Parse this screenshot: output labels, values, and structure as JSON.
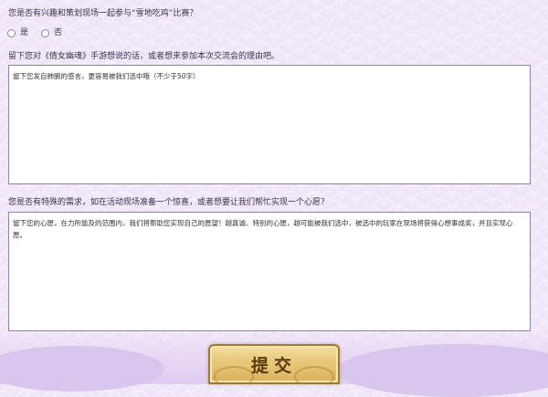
{
  "form": {
    "question1": "您是否有兴趣和策划现场一起参与“雪地吃鸡”比赛？",
    "options": [
      {
        "label": "是"
      },
      {
        "label": "否"
      }
    ],
    "question2": "留下您对《倩女幽魂》手游想说的话，或者想来参加本次交流会的理由吧。",
    "textarea1": {
      "placeholder": "留下您发自肺腑的感言，更容易被我们选中哦（不少于50字）"
    },
    "question3": "您是否有特殊的需求，如在活动现场准备一个惊喜，或者想要让我们帮忙实现一个心愿？",
    "textarea2": {
      "placeholder": "留下您的心愿，在力所能及的范围内，我们将帮助您实现自己的愿望！越真诚、特别的心愿，越可能被我们选中，被选中的玩家在现场将获得心想事成奖，并且实现心愿。"
    },
    "submit_label": "提交"
  },
  "colors": {
    "background": "#efe6f8",
    "textbox_border": "#8d85a8",
    "button_gold": "#e8c878",
    "button_text": "#5a3a12"
  }
}
